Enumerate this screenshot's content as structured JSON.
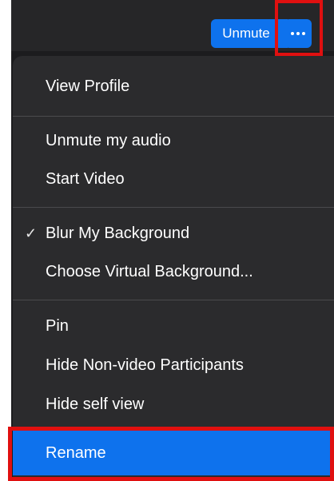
{
  "toolbar": {
    "unmute_label": "Unmute",
    "more_icon": "more-horizontal-icon"
  },
  "menu": {
    "items": [
      {
        "label": "View Profile"
      },
      {
        "label": "Unmute my audio"
      },
      {
        "label": "Start Video"
      },
      {
        "label": "Blur My Background",
        "checked": true
      },
      {
        "label": "Choose Virtual Background..."
      },
      {
        "label": "Pin"
      },
      {
        "label": "Hide Non-video Participants"
      },
      {
        "label": "Hide self view"
      },
      {
        "label": "Rename",
        "selected": true
      }
    ],
    "check_glyph": "✓"
  },
  "colors": {
    "accent": "#0e72ed",
    "highlight_border": "#e01010",
    "menu_bg": "#2b2b2d"
  }
}
